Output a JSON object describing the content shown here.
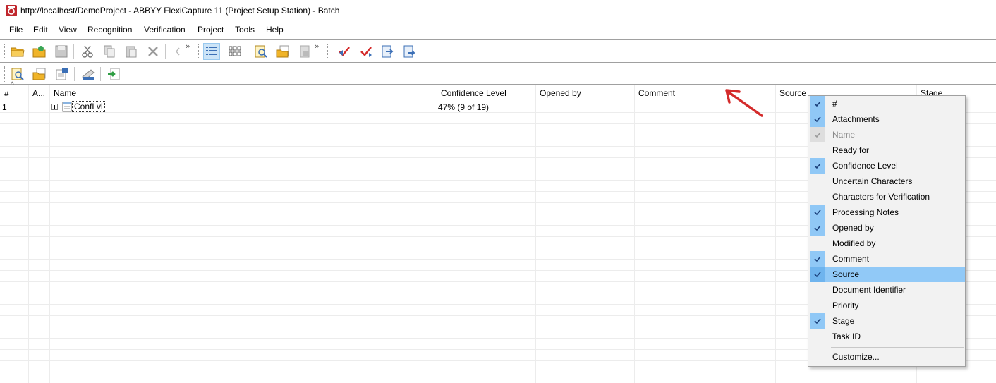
{
  "window": {
    "title": "http://localhost/DemoProject - ABBYY FlexiCapture 11 (Project Setup Station) - Batch"
  },
  "menu": {
    "file": "File",
    "edit": "Edit",
    "view": "View",
    "recognition": "Recognition",
    "verification": "Verification",
    "project": "Project",
    "tools": "Tools",
    "help": "Help"
  },
  "toolbar1": {
    "buttons": [
      "open-folder-icon",
      "open-project-icon",
      "save-icon",
      "cut-icon",
      "copy-icon",
      "paste-icon",
      "delete-icon",
      "undo-icon",
      "details-view-icon",
      "thumbnails-view-icon",
      "find-icon",
      "open-document-icon",
      "close-document-icon",
      "check-rules-icon",
      "check-all-icon",
      "move-to-stage-icon",
      "send-to-stage-icon"
    ],
    "overflow": "»"
  },
  "toolbar2": {
    "buttons": [
      "find-batch-icon",
      "open-batch-icon",
      "batch-properties-icon",
      "scan-icon",
      "import-icon"
    ]
  },
  "grid": {
    "headers": {
      "num": "#",
      "attachments": "A...",
      "name": "Name",
      "confidence": "Confidence Level",
      "opened_by": "Opened by",
      "comment": "Comment",
      "source": "Source",
      "stage": "Stage"
    },
    "sort_indicator": "^",
    "rows": [
      {
        "num": "1",
        "name": "ConfLvl",
        "confidence": "47% (9 of 19)"
      }
    ]
  },
  "context_menu": {
    "items": [
      {
        "label": "#",
        "state": "on"
      },
      {
        "label": "Attachments",
        "state": "on"
      },
      {
        "label": "Name",
        "state": "disabled"
      },
      {
        "label": "Ready for",
        "state": "off"
      },
      {
        "label": "Confidence Level",
        "state": "on"
      },
      {
        "label": "Uncertain Characters",
        "state": "off"
      },
      {
        "label": "Characters for Verification",
        "state": "off"
      },
      {
        "label": "Processing Notes",
        "state": "on"
      },
      {
        "label": "Opened by",
        "state": "on"
      },
      {
        "label": "Modified by",
        "state": "off"
      },
      {
        "label": "Comment",
        "state": "on"
      },
      {
        "label": "Source",
        "state": "on",
        "hover": true
      },
      {
        "label": "Document Identifier",
        "state": "off"
      },
      {
        "label": "Priority",
        "state": "off"
      },
      {
        "label": "Stage",
        "state": "on"
      },
      {
        "label": "Task ID",
        "state": "off"
      }
    ],
    "customize": "Customize..."
  },
  "colors": {
    "check_bg": "#90c8f6",
    "hover_bg": "#91c9f7",
    "annotation": "#d42b2b"
  }
}
